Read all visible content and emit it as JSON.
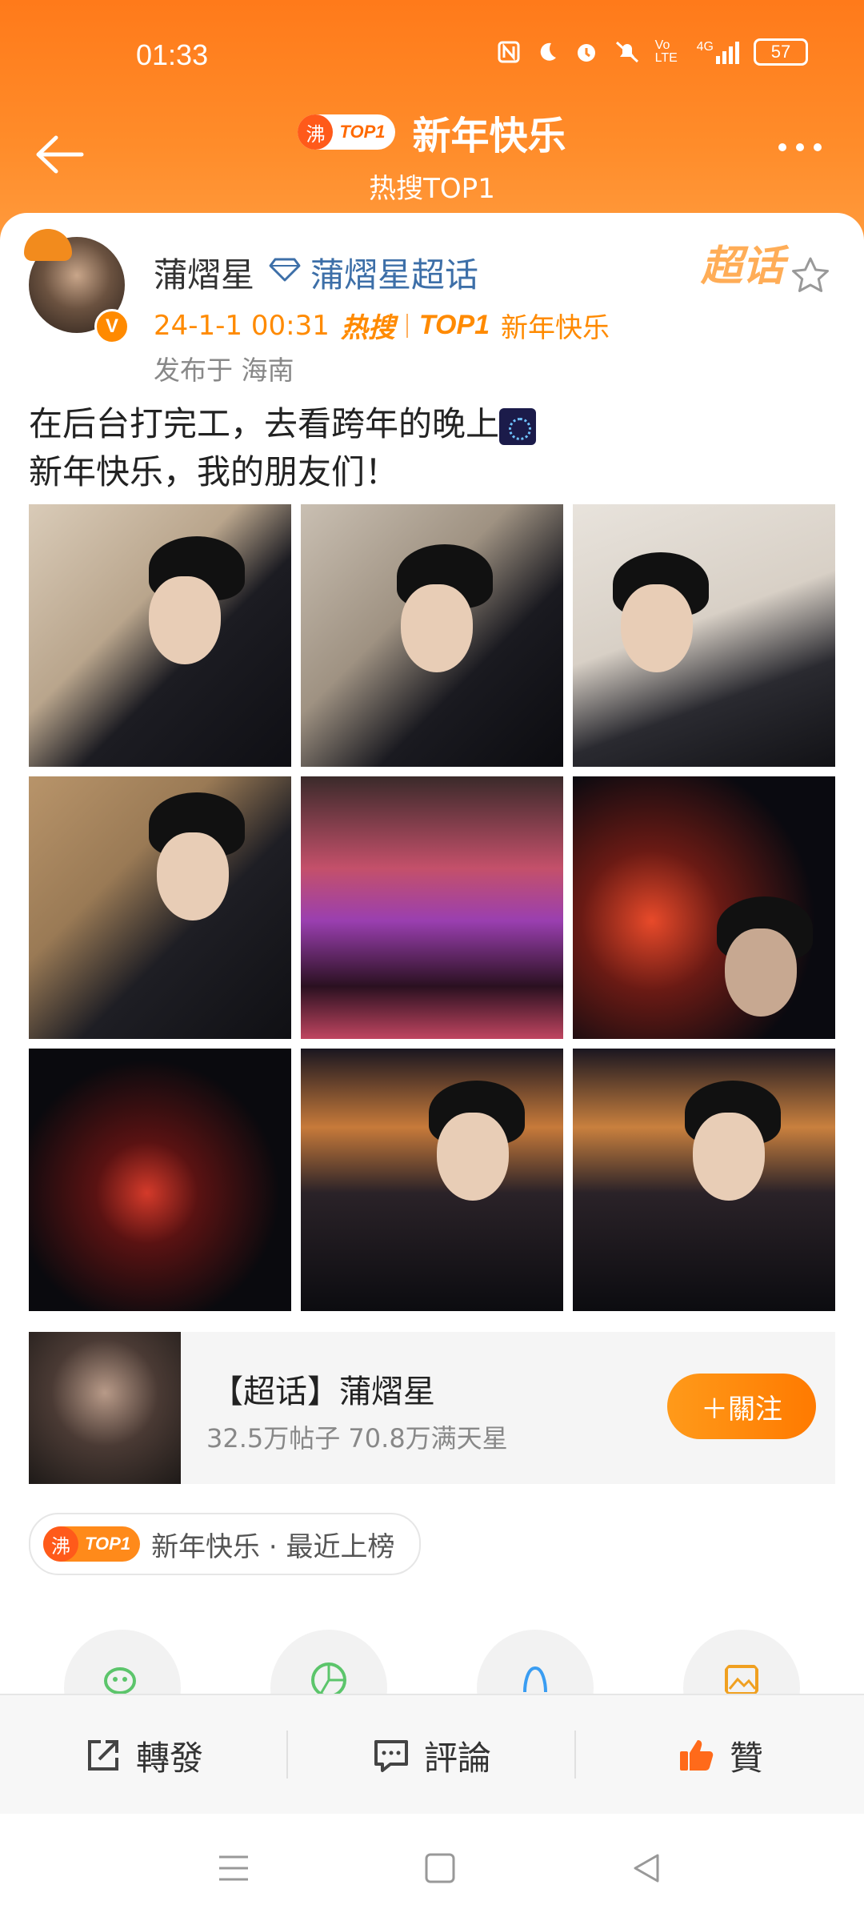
{
  "status_bar": {
    "time": "01:33",
    "icons": [
      "nfc-icon",
      "moon-icon",
      "alarm-icon",
      "mute-icon",
      "volte-icon",
      "4g-signal-icon"
    ],
    "volte_label": "Vo LTE",
    "network_label": "4G",
    "battery": "57"
  },
  "nav": {
    "badge_char": "沸",
    "badge_text": "TOP1",
    "title": "新年快乐",
    "subtitle": "热搜TOP1"
  },
  "post": {
    "username": "蒲熠星",
    "supertopic": "蒲熠星超话",
    "chaohua_badge": "超话",
    "time": "24-1-1 00:31",
    "hot_label": "热搜",
    "hot_top": "TOP1",
    "hot_topic": "新年快乐",
    "location": "发布于 海南",
    "text_line1": "在后台打完工，去看跨年的晚上",
    "text_line2": "新年快乐，我的朋友们！",
    "photo_count": 9
  },
  "topic_card": {
    "name": "【超话】蒲熠星",
    "stats": "32.5万帖子 70.8万满天星",
    "follow_label": "＋關注"
  },
  "hot_pill": {
    "badge_char": "沸",
    "badge_text": "TOP1",
    "text": "新年快乐 · 最近上榜"
  },
  "share_targets": [
    "wechat-icon",
    "moments-icon",
    "qq-icon",
    "album-icon"
  ],
  "actions": {
    "repost": "轉發",
    "comment": "評論",
    "like": "贊"
  },
  "colors": {
    "brand_orange": "#ff8a00",
    "header_orange": "#ff7a1a",
    "link_blue": "#3d6fa8"
  }
}
